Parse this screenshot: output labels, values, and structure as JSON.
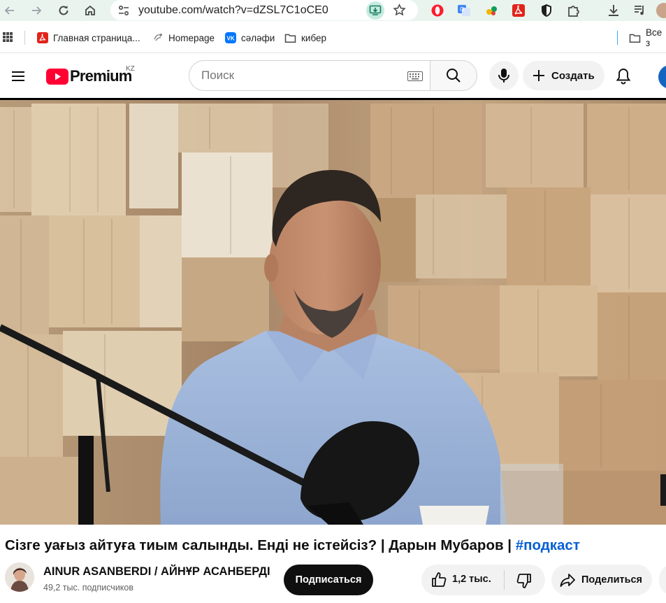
{
  "browser": {
    "url": "youtube.com/watch?v=dZSL7C1oCE0",
    "bookmarks": [
      {
        "label": "Главная страница...",
        "icon": "pdf-icon"
      },
      {
        "label": "Homepage",
        "icon": "homepage-icon"
      },
      {
        "label": "сәләфи",
        "icon": "vk-icon"
      },
      {
        "label": "кибер",
        "icon": "folder-icon"
      },
      {
        "label": "Все з",
        "icon": "folder-icon"
      }
    ]
  },
  "header": {
    "logo_text": "Premium",
    "region": "KZ",
    "search_placeholder": "Поиск",
    "create_label": "Создать"
  },
  "video": {
    "title_main": "Сізге уағыз айтуға тиым салынды. Енді не істейсіз? | Дарын Мубаров | ",
    "title_tag": "#подкаст"
  },
  "channel": {
    "name": "AINUR ASANBERDI / АЙНҰР АСАНБЕРДІ",
    "subscribers": "49,2 тыс. подписчиков",
    "subscribe_label": "Подписаться"
  },
  "actions": {
    "like_count": "1,2 тыс.",
    "share_label": "Поделиться"
  },
  "colors": {
    "brand_red": "#ff0033",
    "link_blue": "#065fd4",
    "chrome_green": "#e9f4ee"
  }
}
